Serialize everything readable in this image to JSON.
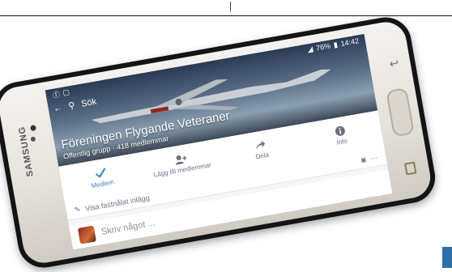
{
  "brand": "SAMSUNG",
  "status": {
    "battery": "76%",
    "time": "14:42"
  },
  "topbar": {
    "search_label": "Sök"
  },
  "group": {
    "name": "Föreningen Flygande Veteraner",
    "meta": "Offentlig grupp · 418 medlemmar"
  },
  "actions": [
    {
      "label": "Medlem",
      "icon": "check-icon"
    },
    {
      "label": "Lägg till medlemmar",
      "icon": "add-person-icon"
    },
    {
      "label": "Dela",
      "icon": "share-icon"
    },
    {
      "label": "Info",
      "icon": "info-icon"
    }
  ],
  "pinned": {
    "label": "Visa fastnålat inlägg"
  },
  "composer": {
    "placeholder": "Skriv något ..."
  },
  "colors": {
    "accent": "#3b82c4",
    "phone_border": "#141414"
  }
}
